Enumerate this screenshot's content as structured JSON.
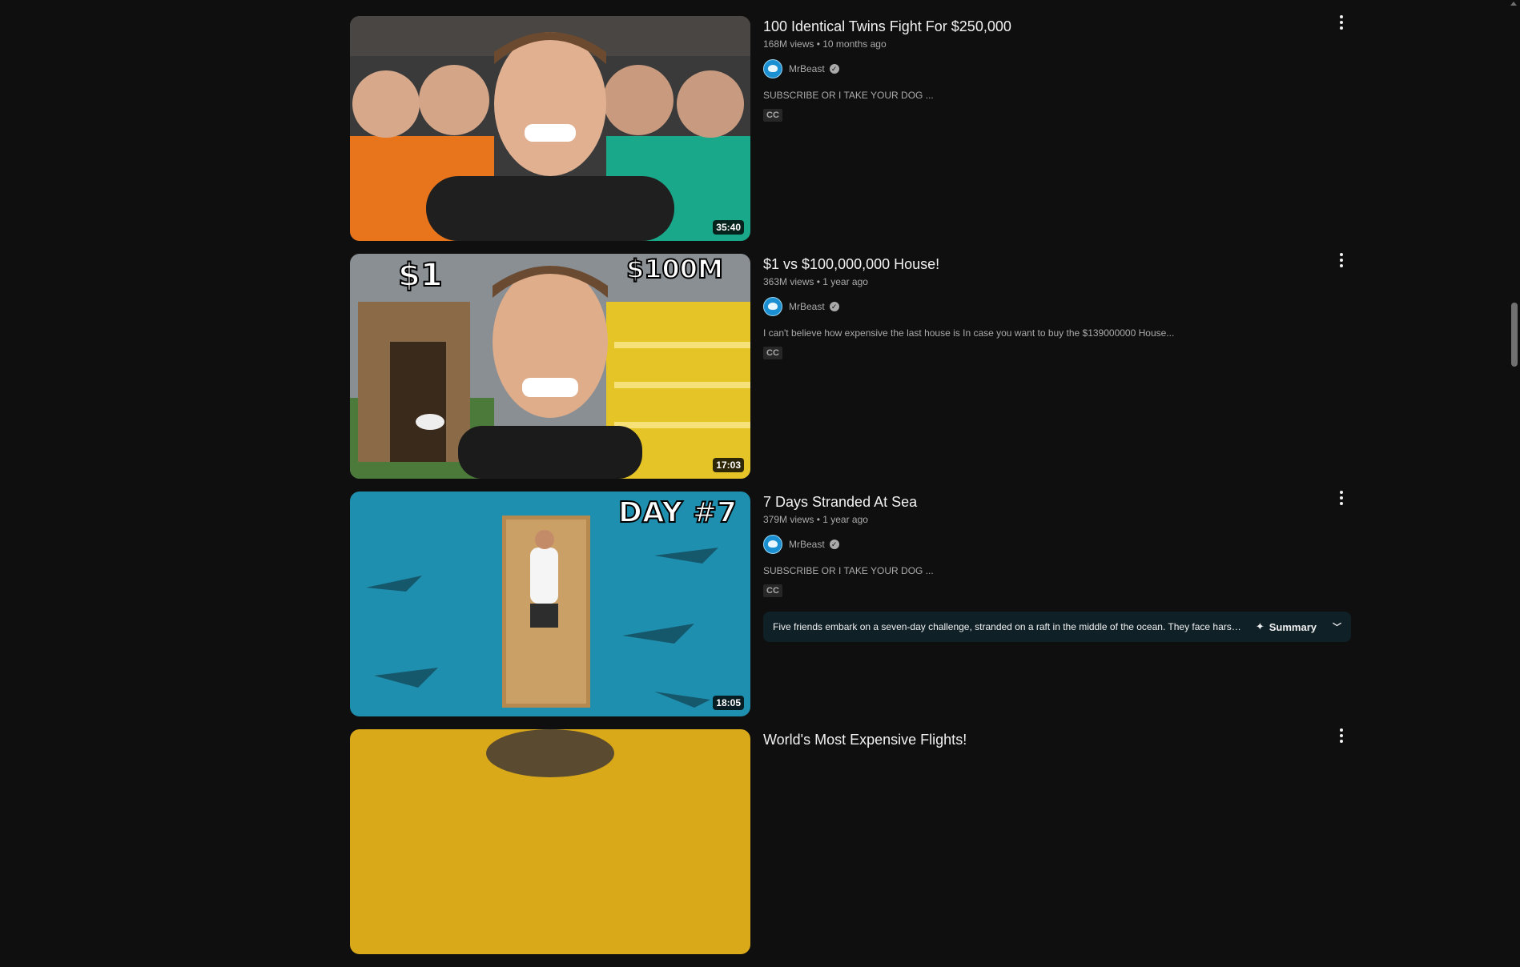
{
  "videos": [
    {
      "title": "100 Identical Twins Fight For $250,000",
      "views": "168M views",
      "age": "10 months ago",
      "stats_sep": "•",
      "channel": "MrBeast",
      "description": "SUBSCRIBE OR I TAKE YOUR DOG ...",
      "badge": "CC",
      "duration": "35:40"
    },
    {
      "title": "$1 vs $100,000,000 House!",
      "views": "363M views",
      "age": "1 year ago",
      "stats_sep": "•",
      "channel": "MrBeast",
      "description": "I can't believe how expensive the last house is In case you want to buy the $139000000 House...",
      "badge": "CC",
      "duration": "17:03",
      "thumb_text_left": "$1",
      "thumb_text_right": "$100M"
    },
    {
      "title": "7 Days Stranded At Sea",
      "views": "379M views",
      "age": "1 year ago",
      "stats_sep": "•",
      "channel": "MrBeast",
      "description": "SUBSCRIBE OR I TAKE YOUR DOG ...",
      "badge": "CC",
      "duration": "18:05",
      "thumb_text": "DAY #7",
      "summary_text": "Five friends embark on a seven-day challenge, stranded on a raft in the middle of the ocean. They face harsh...",
      "summary_label": "Summary"
    },
    {
      "title": "World's Most Expensive Flights!"
    }
  ],
  "icons": {
    "verified": "✓",
    "sparkle": "✦",
    "chevron": "﹀"
  },
  "colors": {
    "background": "#0f0f0f",
    "summary_bg": "#0f2027",
    "secondary_text": "#aaaaaa"
  }
}
